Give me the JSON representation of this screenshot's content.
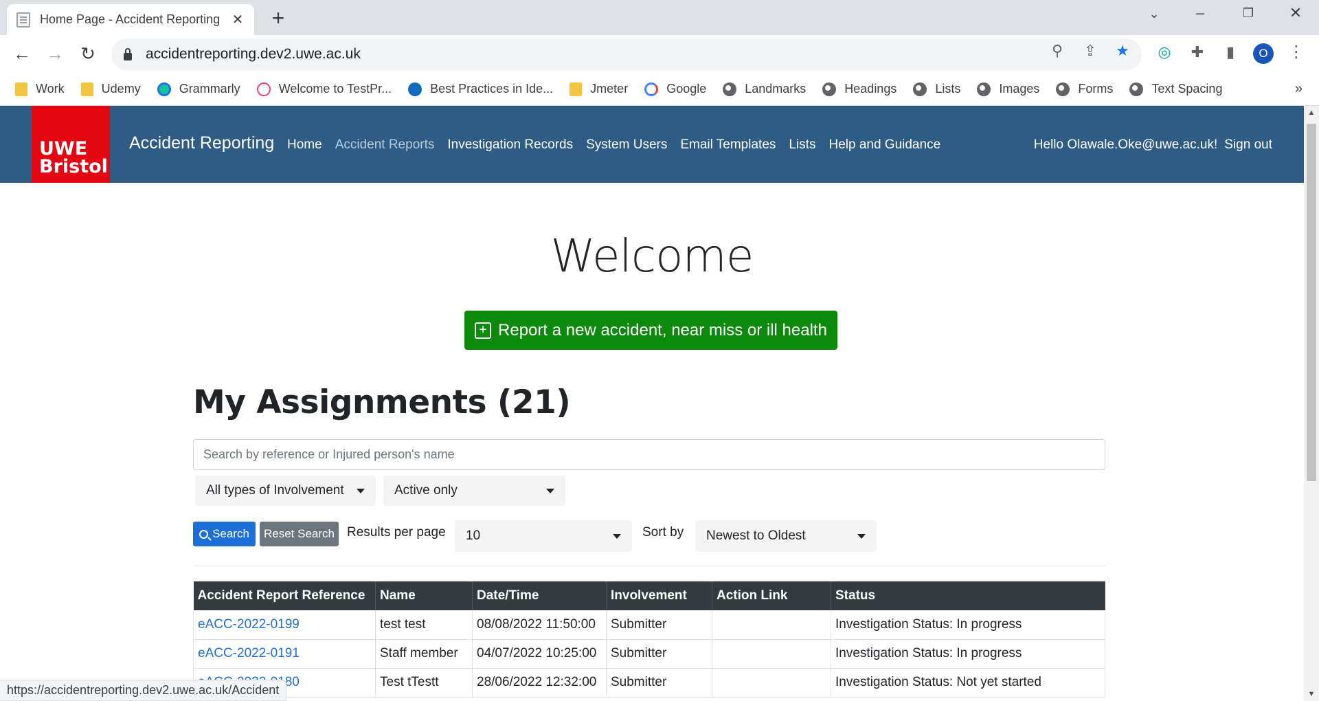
{
  "browser": {
    "tab_title": "Home Page - Accident Reporting",
    "url": "accidentreporting.dev2.uwe.ac.uk",
    "status_url": "https://accidentreporting.dev2.uwe.ac.uk/Accident",
    "profile_initial": "O",
    "bookmarks": [
      {
        "label": "Work",
        "icon": "folder-icon"
      },
      {
        "label": "Udemy",
        "icon": "folder-icon"
      },
      {
        "label": "Grammarly",
        "icon": "grammarly-icon"
      },
      {
        "label": "Welcome to TestPr...",
        "icon": "testproject-icon"
      },
      {
        "label": "Best Practices in Ide...",
        "icon": "cloud-icon"
      },
      {
        "label": "Jmeter",
        "icon": "folder-icon"
      },
      {
        "label": "Google",
        "icon": "google-icon"
      },
      {
        "label": "Landmarks",
        "icon": "globe-icon"
      },
      {
        "label": "Headings",
        "icon": "globe-icon"
      },
      {
        "label": "Lists",
        "icon": "globe-icon"
      },
      {
        "label": "Images",
        "icon": "globe-icon"
      },
      {
        "label": "Forms",
        "icon": "globe-icon"
      },
      {
        "label": "Text Spacing",
        "icon": "globe-icon"
      }
    ]
  },
  "header": {
    "logo_line1": "UWE",
    "logo_line2": "Bristol",
    "brand": "Accident Reporting",
    "nav": [
      "Home",
      "Accident Reports",
      "Investigation Records",
      "System Users",
      "Email Templates",
      "Lists",
      "Help and Guidance"
    ],
    "greeting": "Hello Olawale.Oke@uwe.ac.uk!",
    "signout": "Sign out",
    "colors": {
      "header_bg": "#2e5c85",
      "logo_bg": "#e30613"
    }
  },
  "main": {
    "welcome": "Welcome",
    "report_button": "Report a new accident, near miss or ill health",
    "assignments_title": "My Assignments (21)",
    "search_placeholder": "Search by reference or Injured person's name",
    "involvement_filter": "All types of Involvement",
    "active_filter": "Active only",
    "search_button": "Search",
    "reset_button": "Reset Search",
    "results_label": "Results per page",
    "results_value": "10",
    "sort_label": "Sort by",
    "sort_value": "Newest to Oldest"
  },
  "table": {
    "headers": [
      "Accident Report Reference",
      "Name",
      "Date/Time",
      "Involvement",
      "Action Link",
      "Status"
    ],
    "rows": [
      {
        "ref": "eACC-2022-0199",
        "name": "test test",
        "datetime": "08/08/2022 11:50:00",
        "involvement": "Submitter",
        "action": "",
        "status": "Investigation Status: In progress"
      },
      {
        "ref": "eACC-2022-0191",
        "name": "Staff member",
        "datetime": "04/07/2022 10:25:00",
        "involvement": "Submitter",
        "action": "",
        "status": "Investigation Status: In progress"
      },
      {
        "ref": "eACC-2022-0180",
        "name": "Test tTestt",
        "datetime": "28/06/2022 12:32:00",
        "involvement": "Submitter",
        "action": "",
        "status": "Investigation Status: Not yet started"
      }
    ]
  }
}
